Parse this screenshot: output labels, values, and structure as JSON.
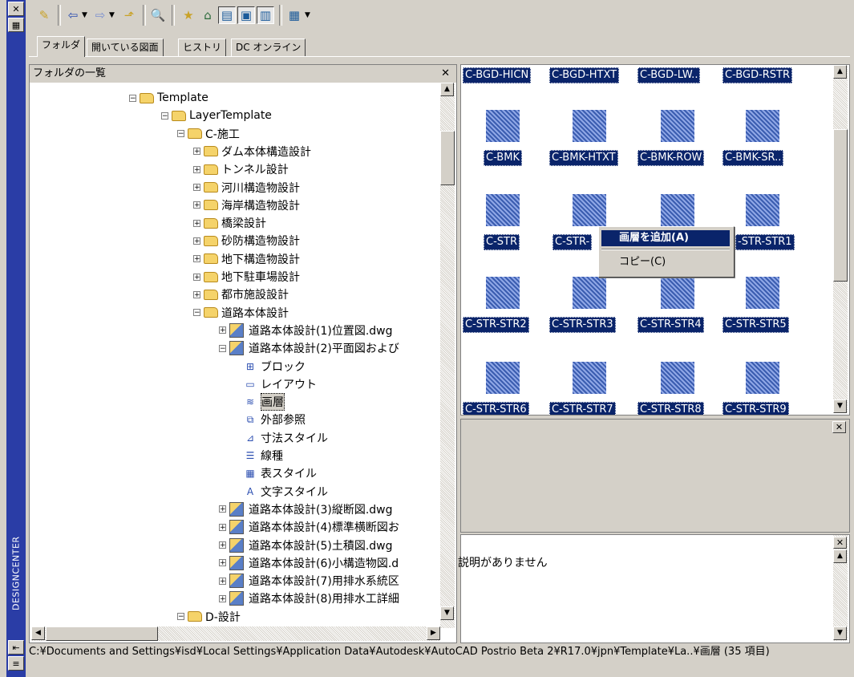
{
  "window": {
    "side_title": "DESIGNCENTER"
  },
  "tabs": [
    "フォルダ",
    "開いている図面",
    "ヒストリ",
    "DC オンライン"
  ],
  "folder_panel": {
    "title": "フォルダの一覧",
    "tree": [
      {
        "label": "Template",
        "expander": "⊟",
        "icon": "folder"
      },
      {
        "label": "LayerTemplate",
        "expander": "⊟",
        "icon": "folder"
      },
      {
        "label": "C-施工",
        "expander": "⊟",
        "icon": "folder"
      },
      {
        "label": "ダム本体構造設計",
        "expander": "⊞",
        "icon": "folder"
      },
      {
        "label": "トンネル設計",
        "expander": "⊞",
        "icon": "folder"
      },
      {
        "label": "河川構造物設計",
        "expander": "⊞",
        "icon": "folder"
      },
      {
        "label": "海岸構造物設計",
        "expander": "⊞",
        "icon": "folder"
      },
      {
        "label": "橋梁設計",
        "expander": "⊞",
        "icon": "folder"
      },
      {
        "label": "砂防構造物設計",
        "expander": "⊞",
        "icon": "folder"
      },
      {
        "label": "地下構造物設計",
        "expander": "⊞",
        "icon": "folder"
      },
      {
        "label": "地下駐車場設計",
        "expander": "⊞",
        "icon": "folder"
      },
      {
        "label": "都市施設設計",
        "expander": "⊞",
        "icon": "folder"
      },
      {
        "label": "道路本体設計",
        "expander": "⊟",
        "icon": "folder"
      },
      {
        "label": "道路本体設計(1)位置図.dwg",
        "expander": "⊞",
        "icon": "dwg"
      },
      {
        "label": "道路本体設計(2)平面図および",
        "expander": "⊟",
        "icon": "dwg"
      },
      {
        "label": "ブロック",
        "expander": "",
        "icon": "block-icon"
      },
      {
        "label": "レイアウト",
        "expander": "",
        "icon": "layout-icon"
      },
      {
        "label": "画層",
        "expander": "",
        "icon": "layer-icon",
        "selected": true
      },
      {
        "label": "外部参照",
        "expander": "",
        "icon": "xref-icon"
      },
      {
        "label": "寸法スタイル",
        "expander": "",
        "icon": "dimstyle-icon"
      },
      {
        "label": "線種",
        "expander": "",
        "icon": "linetype-icon"
      },
      {
        "label": "表スタイル",
        "expander": "",
        "icon": "tablestyle-icon"
      },
      {
        "label": "文字スタイル",
        "expander": "",
        "icon": "textstyle-icon"
      },
      {
        "label": "道路本体設計(3)縦断図.dwg",
        "expander": "⊞",
        "icon": "dwg"
      },
      {
        "label": "道路本体設計(4)標準横断図お",
        "expander": "⊞",
        "icon": "dwg"
      },
      {
        "label": "道路本体設計(5)土積図.dwg",
        "expander": "⊞",
        "icon": "dwg"
      },
      {
        "label": "道路本体設計(6)小構造物図.d",
        "expander": "⊞",
        "icon": "dwg"
      },
      {
        "label": "道路本体設計(7)用排水系統区",
        "expander": "⊞",
        "icon": "dwg"
      },
      {
        "label": "道路本体設計(8)用排水工詳細",
        "expander": "⊞",
        "icon": "dwg"
      },
      {
        "label": "D-設計",
        "expander": "⊟",
        "icon": "folder"
      }
    ]
  },
  "layers": [
    {
      "label": "C-BGD-HICN",
      "icon": false
    },
    {
      "label": "C-BGD-HTXT",
      "icon": false
    },
    {
      "label": "C-BGD-LW..",
      "icon": false
    },
    {
      "label": "C-BGD-RSTR",
      "icon": false
    },
    {
      "label": "C-BMK",
      "icon": true
    },
    {
      "label": "C-BMK-HTXT",
      "icon": true
    },
    {
      "label": "C-BMK-ROW",
      "icon": true
    },
    {
      "label": "C-BMK-SR..",
      "icon": true
    },
    {
      "label": "C-STR",
      "icon": true
    },
    {
      "label": "C-STR-",
      "icon": true
    },
    {
      "label": "",
      "icon": true
    },
    {
      "label": "-STR-STR1",
      "icon": true
    },
    {
      "label": "C-STR-STR2",
      "icon": true
    },
    {
      "label": "C-STR-STR3",
      "icon": true
    },
    {
      "label": "C-STR-STR4",
      "icon": true
    },
    {
      "label": "C-STR-STR5",
      "icon": true
    },
    {
      "label": "C-STR-STR6",
      "icon": true
    },
    {
      "label": "C-STR-STR7",
      "icon": true
    },
    {
      "label": "C-STR-STR8",
      "icon": true
    },
    {
      "label": "C-STR-STR9",
      "icon": true
    }
  ],
  "context_menu": {
    "add_layer": "画層を追加(A)",
    "copy": "コピー(C)"
  },
  "description": {
    "text": "説明がありません"
  },
  "status_bar": {
    "path": "C:¥Documents and Settings¥isd¥Local Settings¥Application Data¥Autodesk¥AutoCAD Postrio Beta 2¥R17.0¥jpn¥Template¥La..¥画層 (35 項目)"
  },
  "colors": {
    "selection": "#0a246a",
    "chrome": "#d4d0c8",
    "sidebar": "#2a3da6"
  }
}
